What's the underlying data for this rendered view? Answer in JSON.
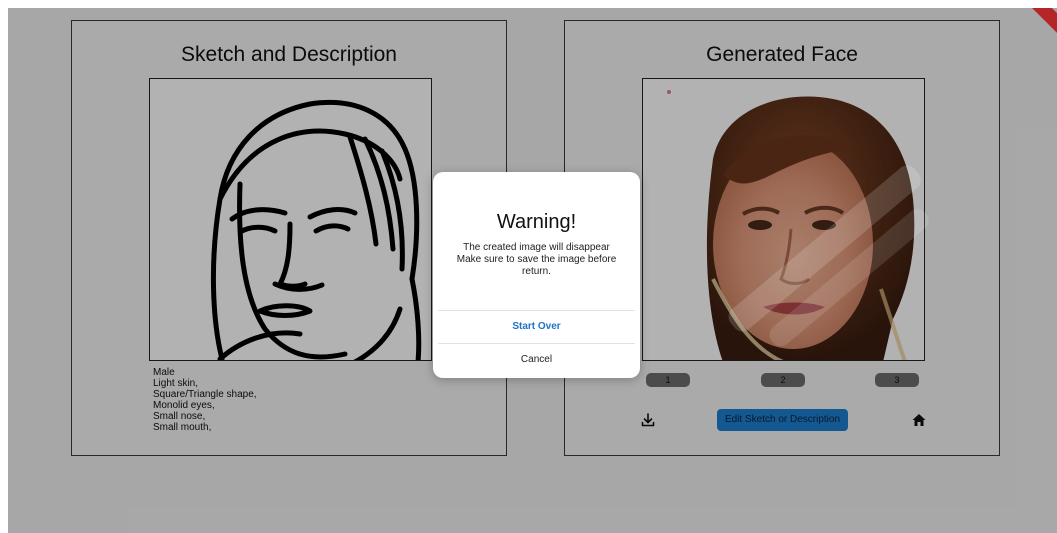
{
  "left_panel": {
    "title": "Sketch and Description",
    "description": [
      "Male",
      "Light skin,",
      "Square/Triangle shape,",
      "Monolid eyes,",
      "Small nose,",
      "Small mouth,"
    ]
  },
  "right_panel": {
    "title": "Generated Face",
    "variant_buttons": [
      "1",
      "2",
      "3"
    ],
    "edit_button_label": "Edit Sketch or Description",
    "download_icon": "download-icon",
    "home_icon": "home-icon"
  },
  "dialog": {
    "title": "Warning!",
    "message_lines": [
      "The created image will disappear",
      "Make sure to save the image before",
      "return."
    ],
    "primary_action": "Start Over",
    "secondary_action": "Cancel"
  },
  "colors": {
    "primary_blue": "#1d7fd1",
    "dialog_action_blue": "#1e73c8",
    "overlay": "rgba(0,0,0,0.30)"
  }
}
